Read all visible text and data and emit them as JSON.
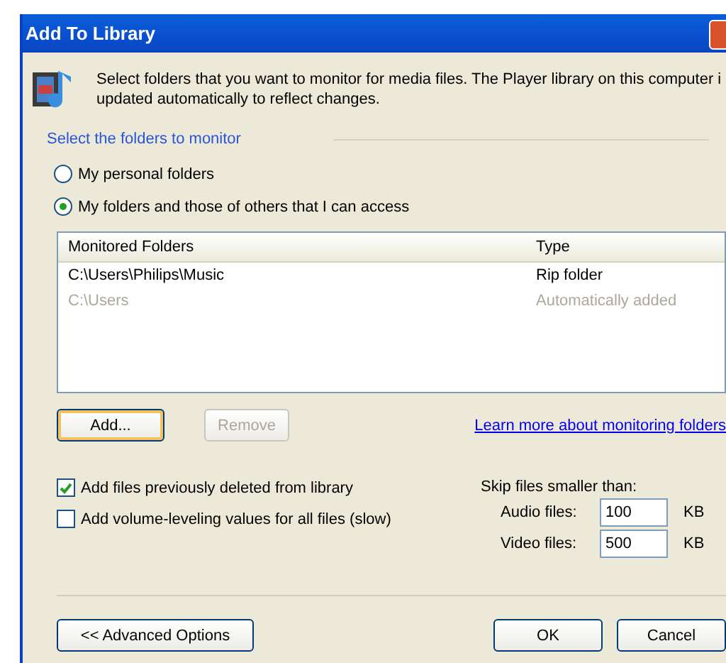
{
  "window": {
    "title": "Add To Library"
  },
  "description": "Select folders that you want to monitor for media files. The Player library on this computer i updated automatically to reflect changes.",
  "section_title": "Select the folders to monitor",
  "radios": [
    {
      "label": "My personal folders",
      "selected": false
    },
    {
      "label": "My folders and those of others that I can access",
      "selected": true
    }
  ],
  "table": {
    "columns": [
      "Monitored Folders",
      "Type"
    ],
    "rows": [
      {
        "cells": [
          "C:\\Users\\Philips\\Music",
          "Rip folder"
        ],
        "disabled": false
      },
      {
        "cells": [
          "C:\\Users",
          "Automatically added"
        ],
        "disabled": true
      }
    ]
  },
  "list_buttons": [
    {
      "label": "Add...",
      "disabled": false,
      "focused": true
    },
    {
      "label": "Remove",
      "disabled": true,
      "focused": false
    }
  ],
  "link": "Learn more about monitoring folders",
  "checkboxes": [
    {
      "label": "Add files previously deleted from library",
      "checked": true
    },
    {
      "label": "Add volume-leveling values for all files (slow)",
      "checked": false
    }
  ],
  "skip": {
    "title": "Skip files smaller than:",
    "fields": [
      {
        "label": "Audio files:",
        "value": "100",
        "unit": "KB"
      },
      {
        "label": "Video files:",
        "value": "500",
        "unit": "KB"
      }
    ]
  },
  "footer": {
    "advanced": "<< Advanced Options",
    "buttons": [
      "OK",
      "Cancel"
    ]
  }
}
